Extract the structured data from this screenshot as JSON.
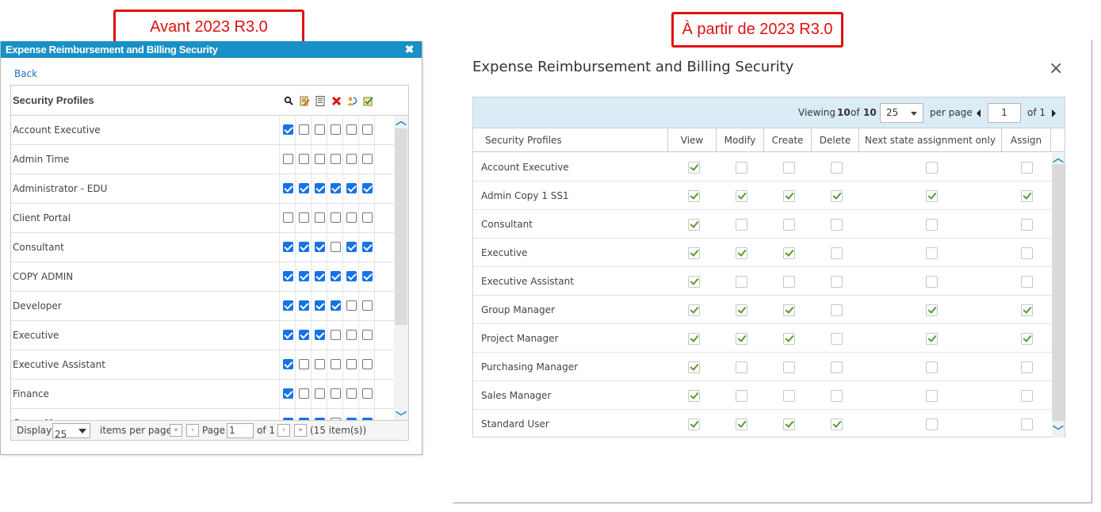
{
  "labels": {
    "before": "Avant 2023 R3.0",
    "after": "À partir de 2023 R3.0"
  },
  "old_dialog": {
    "title": "Expense Reimbursement and Billing Security",
    "close_glyph": "✖",
    "back_label": "Back",
    "column_title": "Security Profiles",
    "header_icons": [
      "magnifier-icon",
      "edit-note-icon",
      "document-icon",
      "delete-x-icon",
      "assign-refresh-icon",
      "approve-check-icon"
    ],
    "rows": [
      {
        "name": "Account Executive",
        "checks": [
          true,
          false,
          false,
          false,
          false,
          false
        ]
      },
      {
        "name": "Admin Time",
        "checks": [
          false,
          false,
          false,
          false,
          false,
          false
        ]
      },
      {
        "name": "Administrator - EDU",
        "checks": [
          true,
          true,
          true,
          true,
          true,
          true
        ]
      },
      {
        "name": "Client Portal",
        "checks": [
          false,
          false,
          false,
          false,
          false,
          false
        ]
      },
      {
        "name": "Consultant",
        "checks": [
          true,
          true,
          true,
          false,
          true,
          true
        ]
      },
      {
        "name": "COPY ADMIN",
        "checks": [
          true,
          true,
          true,
          true,
          true,
          true
        ]
      },
      {
        "name": "Developer",
        "checks": [
          true,
          true,
          true,
          true,
          false,
          false
        ]
      },
      {
        "name": "Executive",
        "checks": [
          true,
          true,
          true,
          false,
          false,
          false
        ]
      },
      {
        "name": "Executive Assistant",
        "checks": [
          true,
          false,
          false,
          false,
          false,
          false
        ]
      },
      {
        "name": "Finance",
        "checks": [
          true,
          false,
          false,
          false,
          false,
          false
        ]
      },
      {
        "name": "Group Manager",
        "checks": [
          true,
          true,
          true,
          false,
          true,
          true
        ]
      }
    ],
    "pager": {
      "display_label": "Display",
      "page_size": "25",
      "items_per_page": "items per page",
      "page_label": "Page",
      "page_value": "1",
      "of_pages": "of 1",
      "item_count": "(15 item(s))"
    }
  },
  "new_dialog": {
    "title": "Expense Reimbursement and Billing Security",
    "close_glyph": "×",
    "toolbar": {
      "viewing_label": "Viewing",
      "viewing_count": "10",
      "of_label": "of",
      "total": "10",
      "page_size": "25",
      "per_page": "per page",
      "page_value": "1",
      "of_pages": "of 1"
    },
    "columns": [
      "Security Profiles",
      "View",
      "Modify",
      "Create",
      "Delete",
      "Next state assignment only",
      "Assign"
    ],
    "rows": [
      {
        "name": "Account Executive",
        "checks": [
          true,
          false,
          false,
          false,
          false,
          false
        ]
      },
      {
        "name": "Admin Copy 1 SS1",
        "checks": [
          true,
          true,
          true,
          true,
          true,
          true
        ]
      },
      {
        "name": "Consultant",
        "checks": [
          true,
          false,
          false,
          false,
          false,
          false
        ]
      },
      {
        "name": "Executive",
        "checks": [
          true,
          true,
          true,
          false,
          false,
          false
        ]
      },
      {
        "name": "Executive Assistant",
        "checks": [
          true,
          false,
          false,
          false,
          false,
          false
        ]
      },
      {
        "name": "Group Manager",
        "checks": [
          true,
          true,
          true,
          false,
          true,
          true
        ]
      },
      {
        "name": "Project Manager",
        "checks": [
          true,
          true,
          true,
          false,
          true,
          true
        ]
      },
      {
        "name": "Purchasing Manager",
        "checks": [
          true,
          false,
          false,
          false,
          false,
          false
        ]
      },
      {
        "name": "Sales Manager",
        "checks": [
          true,
          false,
          false,
          false,
          false,
          false
        ]
      },
      {
        "name": "Standard User",
        "checks": [
          true,
          true,
          true,
          true,
          false,
          false
        ]
      }
    ]
  }
}
